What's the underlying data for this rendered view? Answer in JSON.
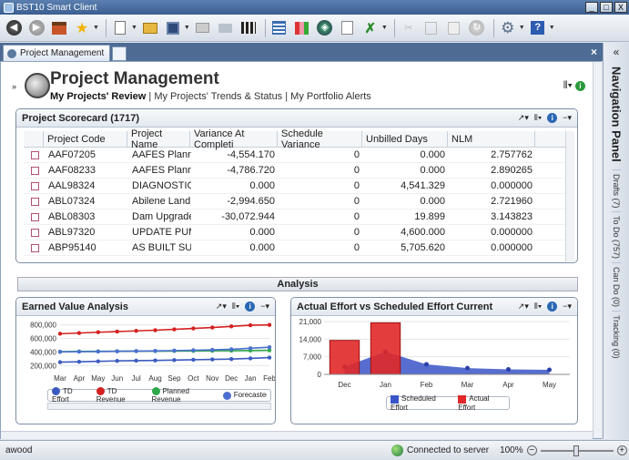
{
  "window": {
    "title": "BST10 Smart Client"
  },
  "tab": {
    "label": "Project Management"
  },
  "page": {
    "title": "Project Management",
    "views": [
      "My Projects' Review",
      "My Projects' Trends & Status",
      "My Portfolio Alerts"
    ]
  },
  "scorecard": {
    "title": "Project Scorecard (1717)",
    "columns": [
      "Project Code",
      "Project Name",
      "Variance At Completi",
      "Schedule Variance",
      "Unbilled Days",
      "NLM"
    ],
    "rows": [
      [
        "AAF07205",
        "AAFES Plannin...",
        "-4,554.170",
        "0",
        "0.000",
        "2.757762"
      ],
      [
        "AAF08233",
        "AAFES Plannin...",
        "-4,786.720",
        "0",
        "0.000",
        "2.890265"
      ],
      [
        "AAL98324",
        "DIAGNOSTIC...",
        "0.000",
        "0",
        "4,541.329",
        "0.000000"
      ],
      [
        "ABL07324",
        "Abilene Land...",
        "-2,994.650",
        "0",
        "0.000",
        "2.721960"
      ],
      [
        "ABL08303",
        "Dam Upgrade...",
        "-30,072.944",
        "0",
        "19.899",
        "3.143823"
      ],
      [
        "ABL97320",
        "UPDATE PUM...",
        "0.000",
        "0",
        "4,600.000",
        "0.000000"
      ],
      [
        "ABP95140",
        "AS BUILT SUR...",
        "0.000",
        "0",
        "5,705.620",
        "0.000000"
      ]
    ]
  },
  "section": {
    "analysis_label": "Analysis"
  },
  "chart_data": [
    {
      "type": "line",
      "title": "Earned Value Analysis",
      "categories": [
        "Mar",
        "Apr",
        "May",
        "Jun",
        "Jul",
        "Aug",
        "Sep",
        "Oct",
        "Nov",
        "Dec",
        "Jan",
        "Feb"
      ],
      "ytick_labels": [
        "800,000",
        "600,000",
        "400,000",
        "200,000"
      ],
      "ylim": [
        150000,
        850000
      ],
      "series": [
        {
          "name": "TD Effort",
          "color": "#3b5bc0",
          "values": [
            250000,
            255000,
            262000,
            268000,
            272000,
            275000,
            280000,
            285000,
            290000,
            295000,
            305000,
            318000
          ]
        },
        {
          "name": "TD Revenue",
          "color": "#d42020",
          "values": [
            670000,
            680000,
            692000,
            702000,
            712000,
            722000,
            735000,
            748000,
            762000,
            778000,
            795000,
            800000
          ]
        },
        {
          "name": "Planned Revenue",
          "color": "#2ea84a",
          "values": [
            405000,
            408000,
            410000,
            412000,
            413000,
            414000,
            415000,
            416000,
            418000,
            420000,
            422000,
            425000
          ]
        },
        {
          "name": "Forecasted",
          "color": "#4a6fd0",
          "values": [
            402000,
            404000,
            407000,
            410000,
            413000,
            417000,
            421000,
            426000,
            432000,
            440000,
            455000,
            470000
          ]
        }
      ],
      "legend_position": "bottom",
      "grid": true
    },
    {
      "type": "bar",
      "title": "Actual Effort vs Scheduled Effort Current",
      "categories": [
        "Dec",
        "Jan",
        "Feb",
        "Mar",
        "Apr",
        "May"
      ],
      "ytick_labels": [
        "21,000",
        "14,000",
        "7,000",
        "0"
      ],
      "ylim": [
        0,
        21000
      ],
      "series": [
        {
          "name": "Scheduled Effort",
          "color": "#3a55c8",
          "values": [
            3000,
            9000,
            4000,
            2500,
            2000,
            1800
          ]
        },
        {
          "name": "Actual Effort",
          "color": "#e02828",
          "values": [
            13500,
            20500,
            0,
            0,
            0,
            0
          ]
        }
      ],
      "legend_position": "bottom",
      "grid": true
    }
  ],
  "nav": {
    "title": "Navigation Panel",
    "items": [
      "Drafts (7)",
      "To Do (757)",
      "Can Do (0)",
      "Tracking (0)"
    ]
  },
  "status": {
    "user": "awood",
    "connection": "Connected to server",
    "zoom": "100%"
  }
}
